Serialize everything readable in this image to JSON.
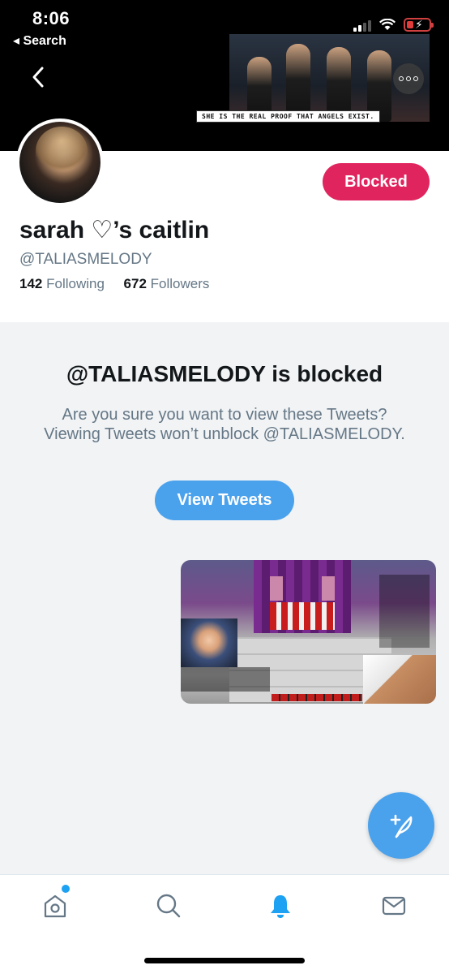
{
  "status_bar": {
    "time": "8:06",
    "back_label": "◂ Search"
  },
  "banner": {
    "caption": "SHE IS THE REAL PROOF THAT ANGELS EXIST."
  },
  "profile": {
    "display_name": "sarah ♡’s caitlin",
    "handle": "@TALIASMELODY",
    "following_count": "142",
    "following_label": "Following",
    "followers_count": "672",
    "followers_label": "Followers",
    "blocked_label": "Blocked"
  },
  "blocked_notice": {
    "title": "@TALIASMELODY is blocked",
    "description": "Are you sure you want to view these Tweets? Viewing Tweets won’t unblock @TALIASMELODY.",
    "view_button": "View Tweets"
  },
  "tab_bar": {
    "items": [
      "home-icon",
      "search-icon",
      "notifications-icon",
      "messages-icon"
    ],
    "active": "notifications-icon"
  },
  "colors": {
    "accent": "#4aa1ec",
    "blocked": "#e0245e",
    "muted_text": "#657786"
  }
}
